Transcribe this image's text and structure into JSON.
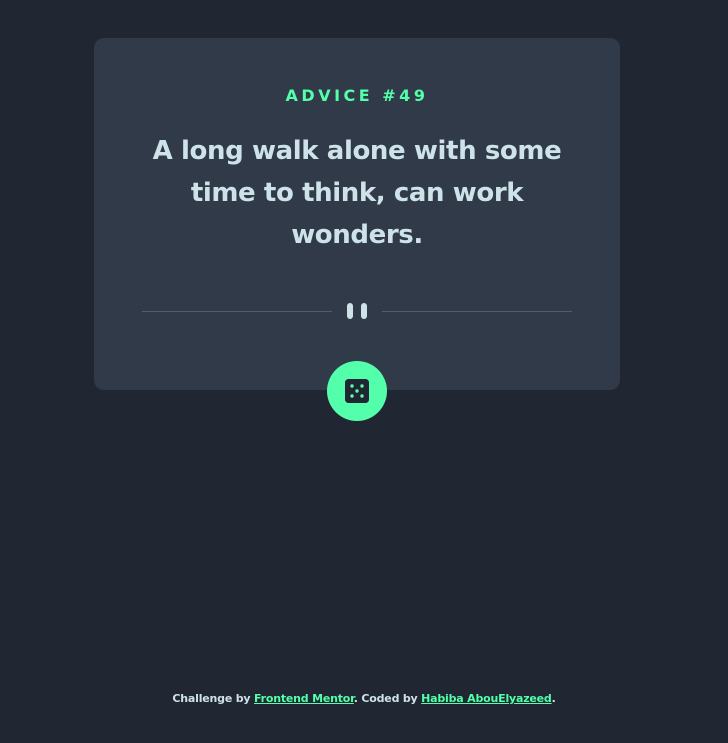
{
  "advice": {
    "label": "ADVICE #49",
    "text": "A long walk alone with some time to think, can work wonders."
  },
  "icons": {
    "divider": "pause-icon",
    "button": "dice-icon"
  },
  "footer": {
    "prefix": "Challenge by ",
    "challenge_link": "Frontend Mentor",
    "middle": ". Coded by ",
    "author_link": "Habiba AbouElyazeed",
    "suffix": "."
  },
  "colors": {
    "background": "#202632",
    "card": "#313a48",
    "accent": "#53ffaa",
    "text": "#cee3e9",
    "divider": "#4f5d74"
  }
}
